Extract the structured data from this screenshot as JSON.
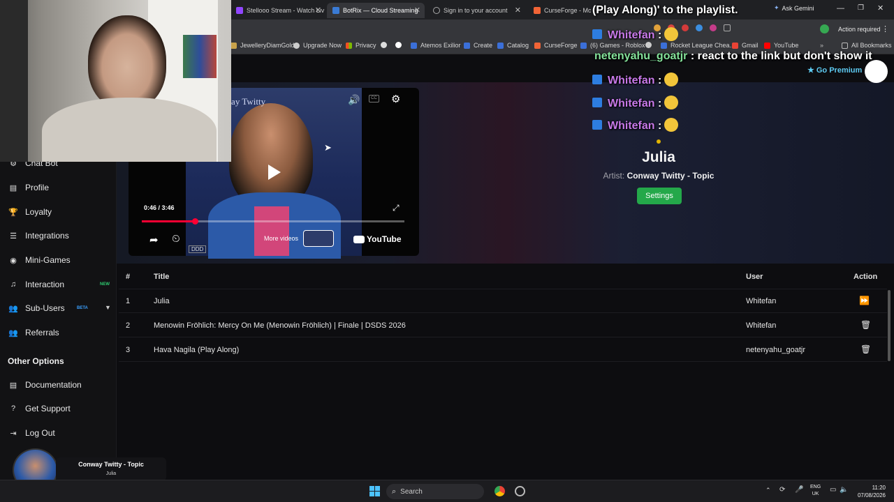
{
  "browser": {
    "tabs": [
      {
        "label": "Stellooo Stream - Watch Liv",
        "color": "#9146ff"
      },
      {
        "label": "BotRix — Cloud Streaming",
        "color": "#3a7bd5"
      },
      {
        "label": "Sign in to your account",
        "color": "#888888"
      },
      {
        "label": "CurseForge - Mods",
        "color": "#f16436"
      }
    ],
    "ask_gemini": "Ask Gemini",
    "action_required": "Action required",
    "bookmarks": [
      "JewelleryDiamGold",
      "Upgrade Now",
      "Privacy",
      "Atemos Exilior",
      "Create",
      "Catalog",
      "CurseForge",
      "(6) Games - Roblox",
      "Rocket League Chea...",
      "Gmail",
      "YouTube"
    ],
    "all_bookmarks": "All Bookmarks"
  },
  "chat": [
    {
      "user": "",
      "text": "(Play Along)' to the playlist."
    },
    {
      "user": "Whitefan",
      "text": ":"
    },
    {
      "user": "netenyahu_goatjr",
      "text": ": react to the link but don't show it"
    },
    {
      "user": "Whitefan",
      "text": ":"
    },
    {
      "user": "Whitefan",
      "text": ":"
    },
    {
      "user": "Whitefan",
      "text": ":"
    }
  ],
  "header": {
    "go_premium": "Go Premium"
  },
  "sidebar": {
    "items": [
      {
        "label": "Chat Bot",
        "icon": "robot-icon"
      },
      {
        "label": "Profile",
        "icon": "id-card-icon"
      },
      {
        "label": "Loyalty",
        "icon": "trophy-icon"
      },
      {
        "label": "Integrations",
        "icon": "list-icon"
      },
      {
        "label": "Mini-Games",
        "icon": "gamepad-icon"
      },
      {
        "label": "Interaction",
        "icon": "music-note-icon",
        "badge": "NEW",
        "badge_color": "#2ecc71"
      },
      {
        "label": "Sub-Users",
        "icon": "users-icon",
        "badge": "BETA",
        "badge_color": "#3aa0ff"
      },
      {
        "label": "Referrals",
        "icon": "user-group-icon"
      }
    ],
    "other_title": "Other Options",
    "other_items": [
      {
        "label": "Documentation",
        "icon": "document-icon"
      },
      {
        "label": "Get Support",
        "icon": "help-icon"
      },
      {
        "label": "Log Out",
        "icon": "logout-icon"
      }
    ]
  },
  "player": {
    "time": "0:46 / 3:46",
    "progress": 0.203,
    "more_videos": "More videos",
    "youtube": "YouTube",
    "watermark": "DDD",
    "art_text": "Conway Twitty"
  },
  "now_playing": {
    "title": "Julia",
    "artist_label": "Artist:",
    "artist": "Conway Twitty - Topic",
    "settings": "Settings"
  },
  "queue": {
    "headers": {
      "num": "#",
      "title": "Title",
      "user": "User",
      "action": "Action"
    },
    "rows": [
      {
        "num": "1",
        "title": "Julia",
        "user": "Whitefan",
        "action": "skip"
      },
      {
        "num": "2",
        "title": "Menowin Fröhlich: Mercy On Me (Menowin Fröhlich) | Finale | DSDS 2026",
        "user": "Whitefan",
        "action": "delete"
      },
      {
        "num": "3",
        "title": "Hava Nagila (Play Along)",
        "user": "netenyahu_goatjr",
        "action": "delete"
      }
    ]
  },
  "mini_player": {
    "artist": "Conway Twitty - Topic",
    "title": "Julia"
  },
  "taskbar": {
    "search": "Search",
    "lang": "ENG",
    "region": "UK",
    "time": "11:20",
    "date": "07/08/2026"
  }
}
